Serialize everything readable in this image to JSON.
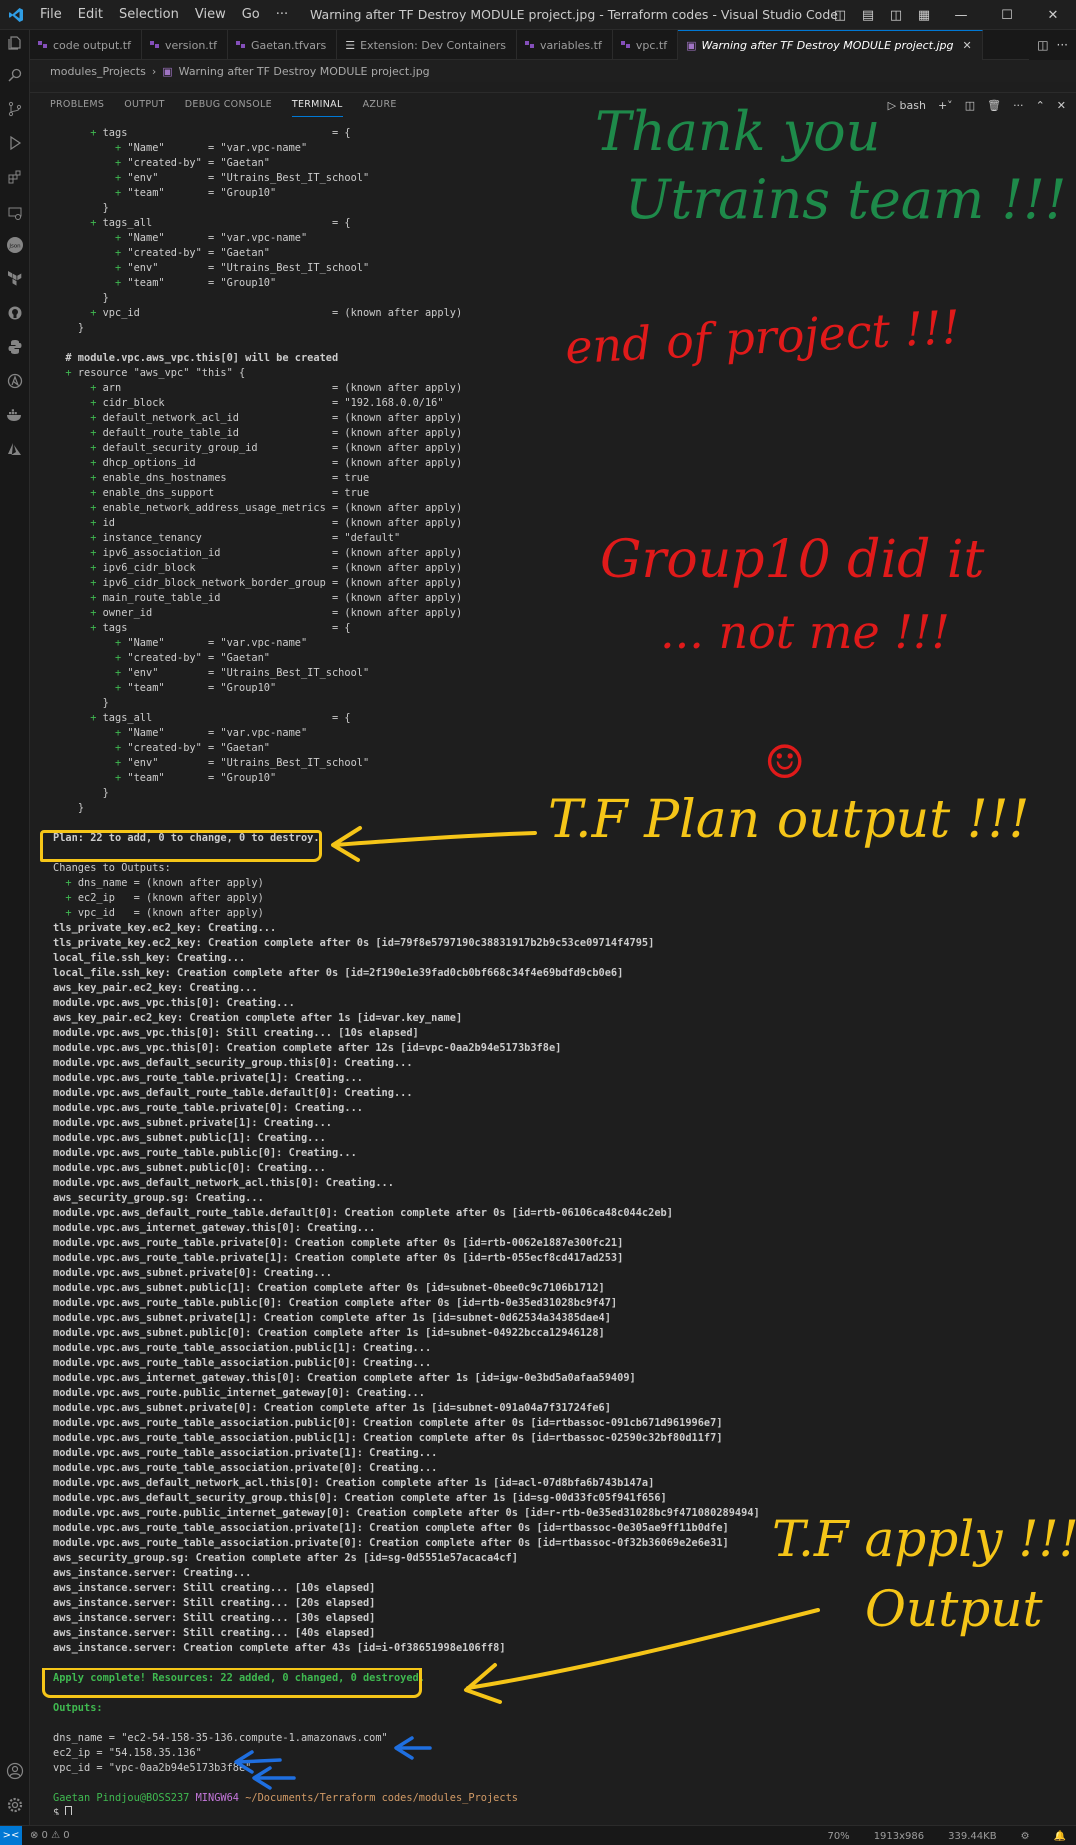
{
  "window": {
    "title": "Warning after TF Destroy MODULE project.jpg - Terraform codes - Visual Studio Code",
    "menu": [
      "File",
      "Edit",
      "Selection",
      "View",
      "Go",
      "···"
    ]
  },
  "tabs": [
    {
      "label": "code output.tf",
      "icon": "terraform-icon"
    },
    {
      "label": "version.tf",
      "icon": "terraform-icon"
    },
    {
      "label": "Gaetan.tfvars",
      "icon": "terraform-icon"
    },
    {
      "label": "Extension: Dev Containers",
      "icon": "extension-icon"
    },
    {
      "label": "variables.tf",
      "icon": "terraform-icon"
    },
    {
      "label": "vpc.tf",
      "icon": "terraform-icon"
    },
    {
      "label": "Warning after TF Destroy MODULE project.jpg",
      "icon": "image-icon",
      "active": true
    }
  ],
  "breadcrumb": {
    "folder": "modules_Projects",
    "file": "Warning after TF Destroy MODULE project.jpg"
  },
  "panel": {
    "tabs": [
      "PROBLEMS",
      "OUTPUT",
      "DEBUG CONSOLE",
      "TERMINAL",
      "AZURE"
    ],
    "active": "TERMINAL",
    "shell": "bash"
  },
  "terminal": {
    "lines": [
      {
        "indent": 6,
        "plus": true,
        "text": "tags                                 = {"
      },
      {
        "indent": 10,
        "plus": true,
        "text": "\"Name\"       = \"var.vpc-name\""
      },
      {
        "indent": 10,
        "plus": true,
        "text": "\"created-by\" = \"Gaetan\""
      },
      {
        "indent": 10,
        "plus": true,
        "text": "\"env\"        = \"Utrains_Best_IT_school\""
      },
      {
        "indent": 10,
        "plus": true,
        "text": "\"team\"       = \"Group10\""
      },
      {
        "indent": 8,
        "plus": false,
        "text": "}"
      },
      {
        "indent": 6,
        "plus": true,
        "text": "tags_all                             = {"
      },
      {
        "indent": 10,
        "plus": true,
        "text": "\"Name\"       = \"var.vpc-name\""
      },
      {
        "indent": 10,
        "plus": true,
        "text": "\"created-by\" = \"Gaetan\""
      },
      {
        "indent": 10,
        "plus": true,
        "text": "\"env\"        = \"Utrains_Best_IT_school\""
      },
      {
        "indent": 10,
        "plus": true,
        "text": "\"team\"       = \"Group10\""
      },
      {
        "indent": 8,
        "plus": false,
        "text": "}"
      },
      {
        "indent": 6,
        "plus": true,
        "text": "vpc_id                               = (known after apply)"
      },
      {
        "indent": 4,
        "plus": false,
        "text": "}"
      },
      {
        "indent": 0,
        "plus": false,
        "text": ""
      },
      {
        "indent": 2,
        "plus": false,
        "bold": true,
        "text": "# module.vpc.aws_vpc.this[0] will be created"
      },
      {
        "indent": 2,
        "plus": true,
        "text": "resource \"aws_vpc\" \"this\" {"
      },
      {
        "indent": 6,
        "plus": true,
        "text": "arn                                  = (known after apply)"
      },
      {
        "indent": 6,
        "plus": true,
        "text": "cidr_block                           = \"192.168.0.0/16\""
      },
      {
        "indent": 6,
        "plus": true,
        "text": "default_network_acl_id               = (known after apply)"
      },
      {
        "indent": 6,
        "plus": true,
        "text": "default_route_table_id               = (known after apply)"
      },
      {
        "indent": 6,
        "plus": true,
        "text": "default_security_group_id            = (known after apply)"
      },
      {
        "indent": 6,
        "plus": true,
        "text": "dhcp_options_id                      = (known after apply)"
      },
      {
        "indent": 6,
        "plus": true,
        "text": "enable_dns_hostnames                 = true"
      },
      {
        "indent": 6,
        "plus": true,
        "text": "enable_dns_support                   = true"
      },
      {
        "indent": 6,
        "plus": true,
        "text": "enable_network_address_usage_metrics = (known after apply)"
      },
      {
        "indent": 6,
        "plus": true,
        "text": "id                                   = (known after apply)"
      },
      {
        "indent": 6,
        "plus": true,
        "text": "instance_tenancy                     = \"default\""
      },
      {
        "indent": 6,
        "plus": true,
        "text": "ipv6_association_id                  = (known after apply)"
      },
      {
        "indent": 6,
        "plus": true,
        "text": "ipv6_cidr_block                      = (known after apply)"
      },
      {
        "indent": 6,
        "plus": true,
        "text": "ipv6_cidr_block_network_border_group = (known after apply)"
      },
      {
        "indent": 6,
        "plus": true,
        "text": "main_route_table_id                  = (known after apply)"
      },
      {
        "indent": 6,
        "plus": true,
        "text": "owner_id                             = (known after apply)"
      },
      {
        "indent": 6,
        "plus": true,
        "text": "tags                                 = {"
      },
      {
        "indent": 10,
        "plus": true,
        "text": "\"Name\"       = \"var.vpc-name\""
      },
      {
        "indent": 10,
        "plus": true,
        "text": "\"created-by\" = \"Gaetan\""
      },
      {
        "indent": 10,
        "plus": true,
        "text": "\"env\"        = \"Utrains_Best_IT_school\""
      },
      {
        "indent": 10,
        "plus": true,
        "text": "\"team\"       = \"Group10\""
      },
      {
        "indent": 8,
        "plus": false,
        "text": "}"
      },
      {
        "indent": 6,
        "plus": true,
        "text": "tags_all                             = {"
      },
      {
        "indent": 10,
        "plus": true,
        "text": "\"Name\"       = \"var.vpc-name\""
      },
      {
        "indent": 10,
        "plus": true,
        "text": "\"created-by\" = \"Gaetan\""
      },
      {
        "indent": 10,
        "plus": true,
        "text": "\"env\"        = \"Utrains_Best_IT_school\""
      },
      {
        "indent": 10,
        "plus": true,
        "text": "\"team\"       = \"Group10\""
      },
      {
        "indent": 8,
        "plus": false,
        "text": "}"
      },
      {
        "indent": 4,
        "plus": false,
        "text": "}"
      },
      {
        "indent": 0,
        "plus": false,
        "text": ""
      },
      {
        "indent": 0,
        "plus": false,
        "bold": true,
        "text": "Plan: 22 to add, 0 to change, 0 to destroy."
      },
      {
        "indent": 0,
        "plus": false,
        "text": ""
      },
      {
        "indent": 0,
        "plus": false,
        "text": "Changes to Outputs:"
      },
      {
        "indent": 2,
        "plus": true,
        "text": "dns_name = (known after apply)"
      },
      {
        "indent": 2,
        "plus": true,
        "text": "ec2_ip   = (known after apply)"
      },
      {
        "indent": 2,
        "plus": true,
        "text": "vpc_id   = (known after apply)"
      },
      {
        "indent": 0,
        "plus": false,
        "bold": true,
        "text": "tls_private_key.ec2_key: Creating..."
      },
      {
        "indent": 0,
        "plus": false,
        "bold": true,
        "text": "tls_private_key.ec2_key: Creation complete after 0s [id=79f8e5797190c38831917b2b9c53ce09714f4795]"
      },
      {
        "indent": 0,
        "plus": false,
        "bold": true,
        "text": "local_file.ssh_key: Creating..."
      },
      {
        "indent": 0,
        "plus": false,
        "bold": true,
        "text": "local_file.ssh_key: Creation complete after 0s [id=2f190e1e39fad0cb0bf668c34f4e69bdfd9cb0e6]"
      },
      {
        "indent": 0,
        "plus": false,
        "bold": true,
        "text": "aws_key_pair.ec2_key: Creating..."
      },
      {
        "indent": 0,
        "plus": false,
        "bold": true,
        "text": "module.vpc.aws_vpc.this[0]: Creating..."
      },
      {
        "indent": 0,
        "plus": false,
        "bold": true,
        "text": "aws_key_pair.ec2_key: Creation complete after 1s [id=var.key_name]"
      },
      {
        "indent": 0,
        "plus": false,
        "bold": true,
        "text": "module.vpc.aws_vpc.this[0]: Still creating... [10s elapsed]"
      },
      {
        "indent": 0,
        "plus": false,
        "bold": true,
        "text": "module.vpc.aws_vpc.this[0]: Creation complete after 12s [id=vpc-0aa2b94e5173b3f8e]"
      },
      {
        "indent": 0,
        "plus": false,
        "bold": true,
        "text": "module.vpc.aws_default_security_group.this[0]: Creating..."
      },
      {
        "indent": 0,
        "plus": false,
        "bold": true,
        "text": "module.vpc.aws_route_table.private[1]: Creating..."
      },
      {
        "indent": 0,
        "plus": false,
        "bold": true,
        "text": "module.vpc.aws_default_route_table.default[0]: Creating..."
      },
      {
        "indent": 0,
        "plus": false,
        "bold": true,
        "text": "module.vpc.aws_route_table.private[0]: Creating..."
      },
      {
        "indent": 0,
        "plus": false,
        "bold": true,
        "text": "module.vpc.aws_subnet.private[1]: Creating..."
      },
      {
        "indent": 0,
        "plus": false,
        "bold": true,
        "text": "module.vpc.aws_subnet.public[1]: Creating..."
      },
      {
        "indent": 0,
        "plus": false,
        "bold": true,
        "text": "module.vpc.aws_route_table.public[0]: Creating..."
      },
      {
        "indent": 0,
        "plus": false,
        "bold": true,
        "text": "module.vpc.aws_subnet.public[0]: Creating..."
      },
      {
        "indent": 0,
        "plus": false,
        "bold": true,
        "text": "module.vpc.aws_default_network_acl.this[0]: Creating..."
      },
      {
        "indent": 0,
        "plus": false,
        "bold": true,
        "text": "aws_security_group.sg: Creating..."
      },
      {
        "indent": 0,
        "plus": false,
        "bold": true,
        "text": "module.vpc.aws_default_route_table.default[0]: Creation complete after 0s [id=rtb-06106ca48c044c2eb]"
      },
      {
        "indent": 0,
        "plus": false,
        "bold": true,
        "text": "module.vpc.aws_internet_gateway.this[0]: Creating..."
      },
      {
        "indent": 0,
        "plus": false,
        "bold": true,
        "text": "module.vpc.aws_route_table.private[0]: Creation complete after 0s [id=rtb-0062e1887e300fc21]"
      },
      {
        "indent": 0,
        "plus": false,
        "bold": true,
        "text": "module.vpc.aws_route_table.private[1]: Creation complete after 0s [id=rtb-055ecf8cd417ad253]"
      },
      {
        "indent": 0,
        "plus": false,
        "bold": true,
        "text": "module.vpc.aws_subnet.private[0]: Creating..."
      },
      {
        "indent": 0,
        "plus": false,
        "bold": true,
        "text": "module.vpc.aws_subnet.public[1]: Creation complete after 0s [id=subnet-0bee0c9c7106b1712]"
      },
      {
        "indent": 0,
        "plus": false,
        "bold": true,
        "text": "module.vpc.aws_route_table.public[0]: Creation complete after 0s [id=rtb-0e35ed31028bc9f47]"
      },
      {
        "indent": 0,
        "plus": false,
        "bold": true,
        "text": "module.vpc.aws_subnet.private[1]: Creation complete after 1s [id=subnet-0d62534a34385dae4]"
      },
      {
        "indent": 0,
        "plus": false,
        "bold": true,
        "text": "module.vpc.aws_subnet.public[0]: Creation complete after 1s [id=subnet-04922bcca12946128]"
      },
      {
        "indent": 0,
        "plus": false,
        "bold": true,
        "text": "module.vpc.aws_route_table_association.public[1]: Creating..."
      },
      {
        "indent": 0,
        "plus": false,
        "bold": true,
        "text": "module.vpc.aws_route_table_association.public[0]: Creating..."
      },
      {
        "indent": 0,
        "plus": false,
        "bold": true,
        "text": "module.vpc.aws_internet_gateway.this[0]: Creation complete after 1s [id=igw-0e3bd5a0afaa59409]"
      },
      {
        "indent": 0,
        "plus": false,
        "bold": true,
        "text": "module.vpc.aws_route.public_internet_gateway[0]: Creating..."
      },
      {
        "indent": 0,
        "plus": false,
        "bold": true,
        "text": "module.vpc.aws_subnet.private[0]: Creation complete after 1s [id=subnet-091a04a7f31724fe6]"
      },
      {
        "indent": 0,
        "plus": false,
        "bold": true,
        "text": "module.vpc.aws_route_table_association.public[0]: Creation complete after 0s [id=rtbassoc-091cb671d961996e7]"
      },
      {
        "indent": 0,
        "plus": false,
        "bold": true,
        "text": "module.vpc.aws_route_table_association.public[1]: Creation complete after 0s [id=rtbassoc-02590c32bf80d11f7]"
      },
      {
        "indent": 0,
        "plus": false,
        "bold": true,
        "text": "module.vpc.aws_route_table_association.private[1]: Creating..."
      },
      {
        "indent": 0,
        "plus": false,
        "bold": true,
        "text": "module.vpc.aws_route_table_association.private[0]: Creating..."
      },
      {
        "indent": 0,
        "plus": false,
        "bold": true,
        "text": "module.vpc.aws_default_network_acl.this[0]: Creation complete after 1s [id=acl-07d8bfa6b743b147a]"
      },
      {
        "indent": 0,
        "plus": false,
        "bold": true,
        "text": "module.vpc.aws_default_security_group.this[0]: Creation complete after 1s [id=sg-00d33fc05f941f656]"
      },
      {
        "indent": 0,
        "plus": false,
        "bold": true,
        "text": "module.vpc.aws_route.public_internet_gateway[0]: Creation complete after 0s [id=r-rtb-0e35ed31028bc9f471080289494]"
      },
      {
        "indent": 0,
        "plus": false,
        "bold": true,
        "text": "module.vpc.aws_route_table_association.private[1]: Creation complete after 0s [id=rtbassoc-0e305ae9ff11b0dfe]"
      },
      {
        "indent": 0,
        "plus": false,
        "bold": true,
        "text": "module.vpc.aws_route_table_association.private[0]: Creation complete after 0s [id=rtbassoc-0f32b36069e2e6e31]"
      },
      {
        "indent": 0,
        "plus": false,
        "bold": true,
        "text": "aws_security_group.sg: Creation complete after 2s [id=sg-0d5551e57acaca4cf]"
      },
      {
        "indent": 0,
        "plus": false,
        "bold": true,
        "text": "aws_instance.server: Creating..."
      },
      {
        "indent": 0,
        "plus": false,
        "bold": true,
        "text": "aws_instance.server: Still creating... [10s elapsed]"
      },
      {
        "indent": 0,
        "plus": false,
        "bold": true,
        "text": "aws_instance.server: Still creating... [20s elapsed]"
      },
      {
        "indent": 0,
        "plus": false,
        "bold": true,
        "text": "aws_instance.server: Still creating... [30s elapsed]"
      },
      {
        "indent": 0,
        "plus": false,
        "bold": true,
        "text": "aws_instance.server: Still creating... [40s elapsed]"
      },
      {
        "indent": 0,
        "plus": false,
        "bold": true,
        "text": "aws_instance.server: Creation complete after 43s [id=i-0f38651998e106ff8]"
      },
      {
        "indent": 0,
        "plus": false,
        "text": ""
      },
      {
        "indent": 0,
        "plus": false,
        "bold": true,
        "green": true,
        "text": "Apply complete! Resources: 22 added, 0 changed, 0 destroyed."
      },
      {
        "indent": 0,
        "plus": false,
        "text": ""
      },
      {
        "indent": 0,
        "plus": false,
        "bold": true,
        "green": true,
        "text": "Outputs:"
      },
      {
        "indent": 0,
        "plus": false,
        "text": ""
      },
      {
        "indent": 0,
        "plus": false,
        "text": "dns_name = \"ec2-54-158-35-136.compute-1.amazonaws.com\""
      },
      {
        "indent": 0,
        "plus": false,
        "text": "ec2_ip = \"54.158.35.136\""
      },
      {
        "indent": 0,
        "plus": false,
        "text": "vpc_id = \"vpc-0aa2b94e5173b3f8e\""
      },
      {
        "indent": 0,
        "plus": false,
        "text": ""
      }
    ],
    "prompt": {
      "user": "Gaetan Pindjou@BOSS237",
      "system": "MINGW64",
      "path": "~/Documents/Terraform codes/modules_Projects",
      "symbol": "$"
    }
  },
  "annotations": {
    "thank_you_1": "Thank you",
    "thank_you_2": "Utrains team !!!",
    "end_of_project": "end of project !!!",
    "group10_1": "Group10 did it",
    "group10_2": "... not me !!!",
    "smiley": "☺",
    "plan_output": "T.F  Plan output !!!",
    "apply_1": "T.F apply !!!",
    "apply_2": "Output",
    "colors": {
      "green": "#1e8a4a",
      "red": "#e01a1a",
      "gold": "#f5c518",
      "blue": "#1f6fe0"
    }
  },
  "statusbar": {
    "remote": "><",
    "problems": "⊗ 0 ⚠ 0",
    "zoom": "70%",
    "dimensions": "1913x986",
    "filesize": "339.44KB"
  }
}
